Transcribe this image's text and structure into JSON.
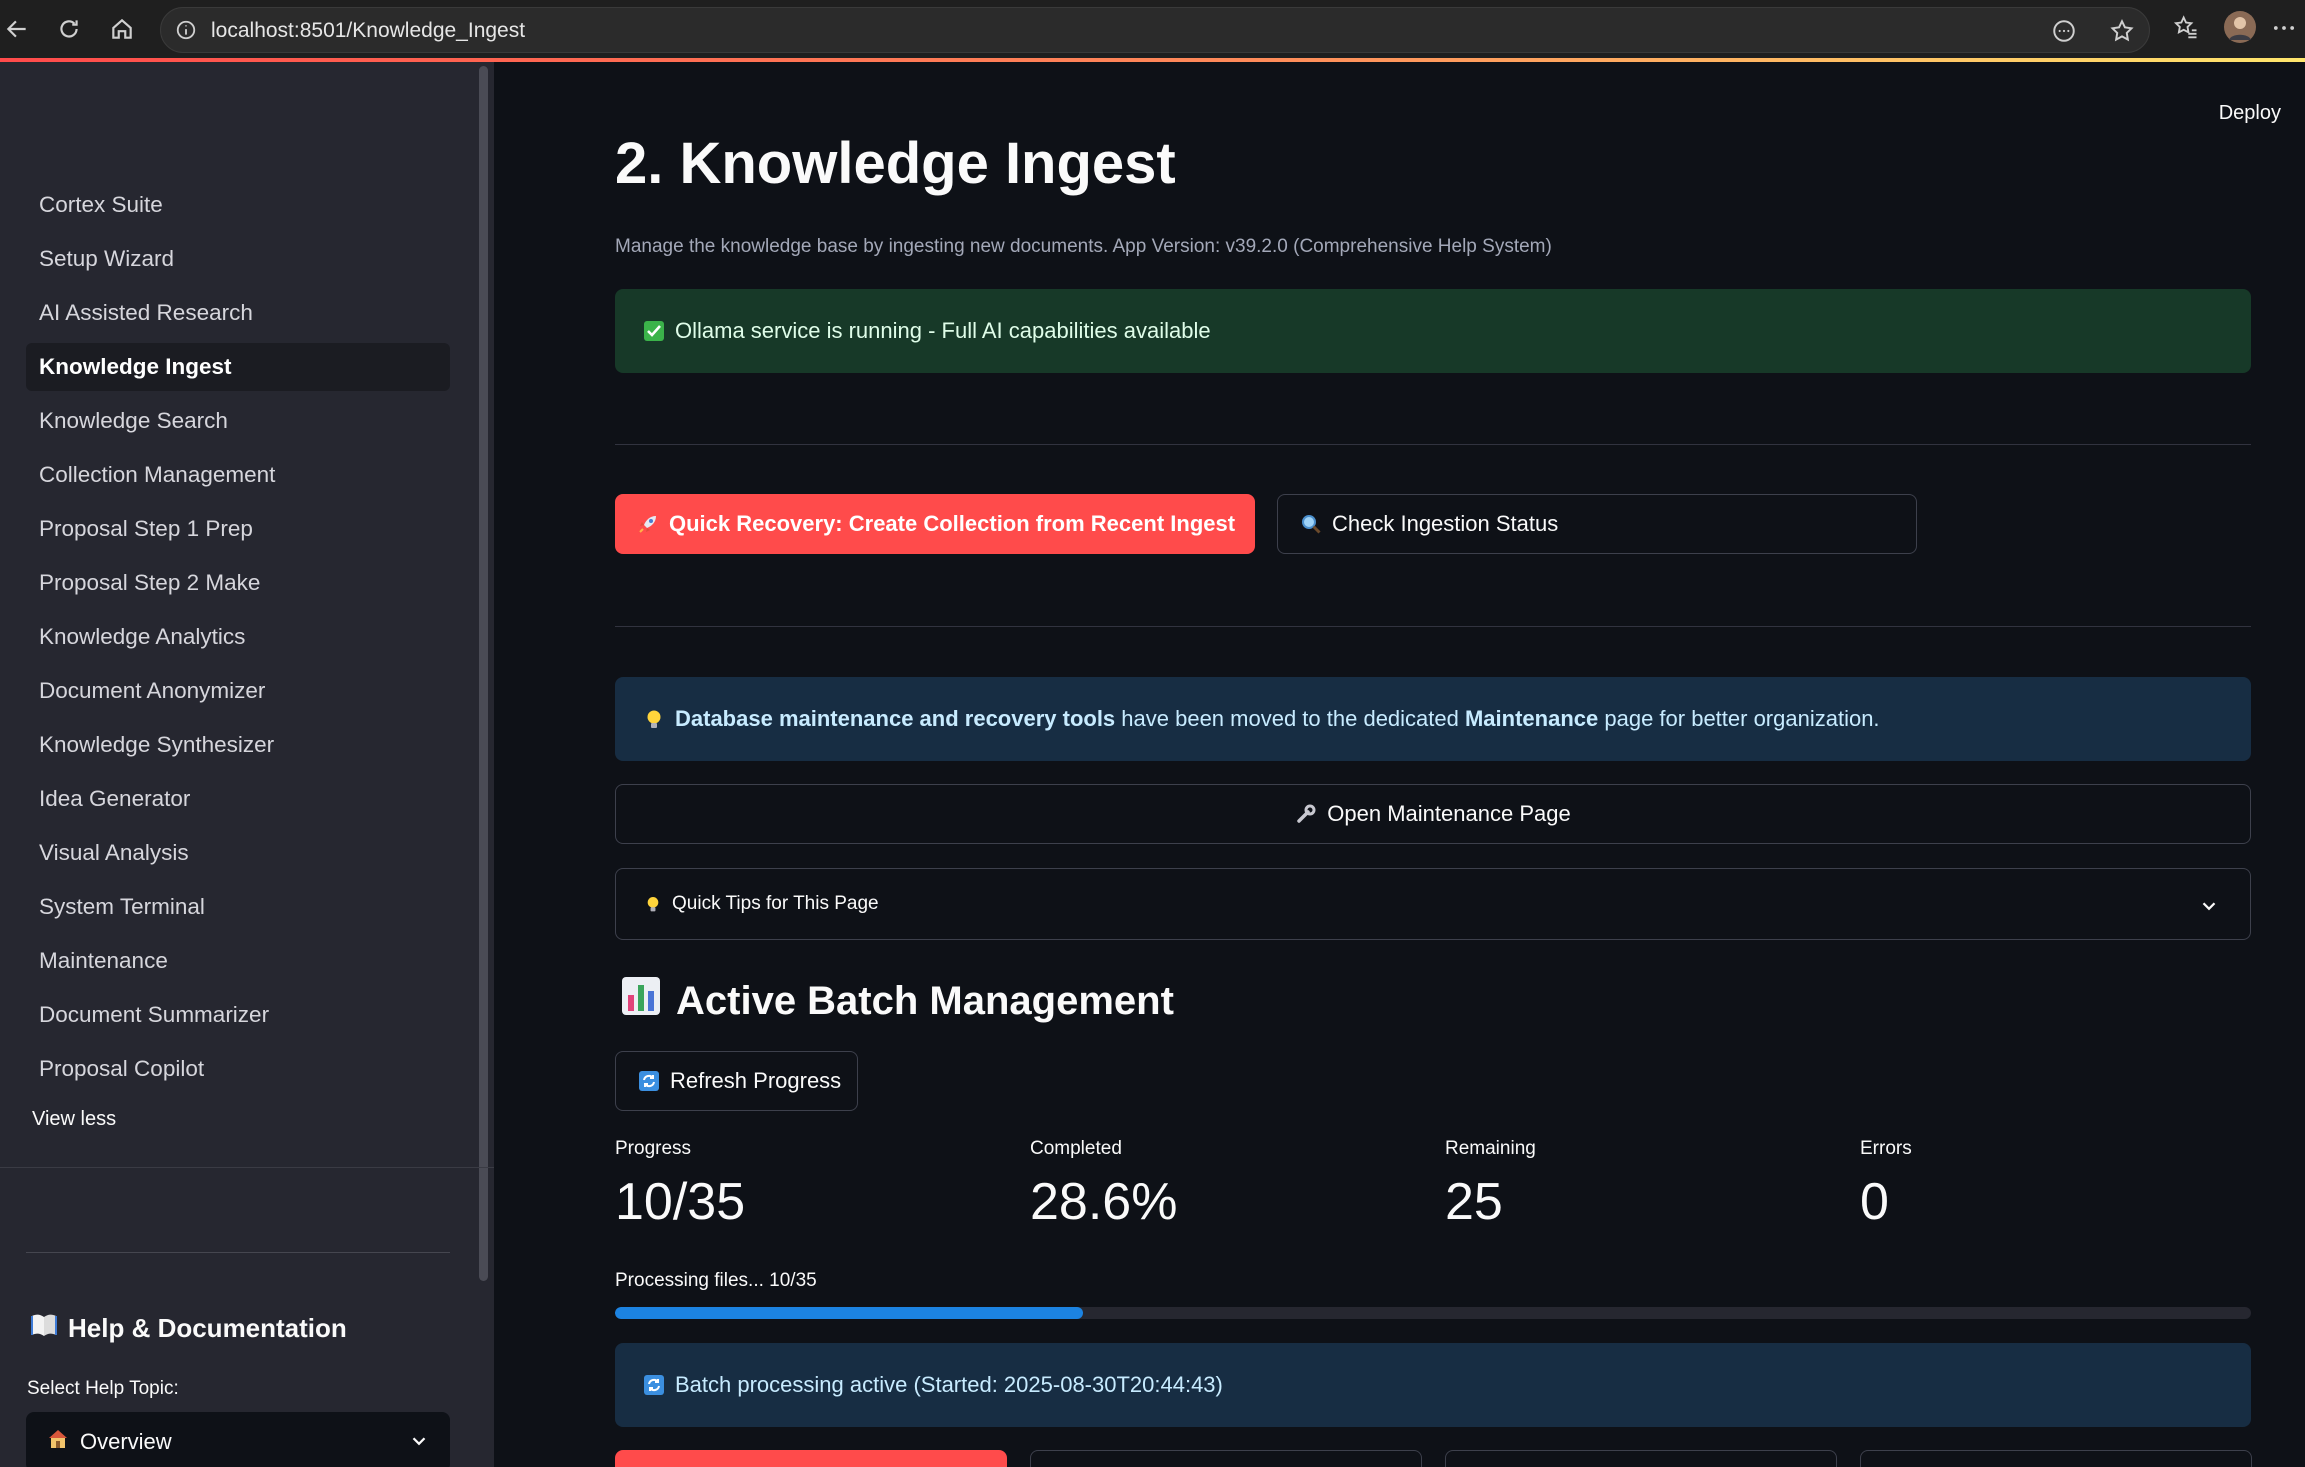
{
  "browser": {
    "url": "localhost:8501/Knowledge_Ingest"
  },
  "sidebar": {
    "items": [
      {
        "label": "Cortex Suite",
        "active": false
      },
      {
        "label": "Setup Wizard",
        "active": false
      },
      {
        "label": "AI Assisted Research",
        "active": false
      },
      {
        "label": "Knowledge Ingest",
        "active": true
      },
      {
        "label": "Knowledge Search",
        "active": false
      },
      {
        "label": "Collection Management",
        "active": false
      },
      {
        "label": "Proposal Step 1 Prep",
        "active": false
      },
      {
        "label": "Proposal Step 2 Make",
        "active": false
      },
      {
        "label": "Knowledge Analytics",
        "active": false
      },
      {
        "label": "Document Anonymizer",
        "active": false
      },
      {
        "label": "Knowledge Synthesizer",
        "active": false
      },
      {
        "label": "Idea Generator",
        "active": false
      },
      {
        "label": "Visual Analysis",
        "active": false
      },
      {
        "label": "System Terminal",
        "active": false
      },
      {
        "label": "Maintenance",
        "active": false
      },
      {
        "label": "Document Summarizer",
        "active": false
      },
      {
        "label": "Proposal Copilot",
        "active": false
      }
    ],
    "view_less": "View less",
    "help_heading": "Help & Documentation",
    "help_topic_label": "Select Help Topic:",
    "help_topic_value": "Overview"
  },
  "header": {
    "deploy": "Deploy"
  },
  "main": {
    "title": "2. Knowledge Ingest",
    "caption": "Manage the knowledge base by ingesting new documents. App Version: v39.2.0 (Comprehensive Help System)",
    "ollama_status": "Ollama service is running - Full AI capabilities available",
    "quick_recovery_button": "Quick Recovery: Create Collection from Recent Ingest",
    "check_status_button": "Check Ingestion Status",
    "maintenance_notice": {
      "bold1": "Database maintenance and recovery tools",
      "text1": " have been moved to the dedicated ",
      "bold2": "Maintenance",
      "text2": " page for better organization."
    },
    "open_maintenance_button": "Open Maintenance Page",
    "quick_tips": "Quick Tips for This Page",
    "batch_heading": "Active Batch Management",
    "refresh_button": "Refresh Progress",
    "metrics": [
      {
        "label": "Progress",
        "value": "10/35"
      },
      {
        "label": "Completed",
        "value": "28.6%"
      },
      {
        "label": "Remaining",
        "value": "25"
      },
      {
        "label": "Errors",
        "value": "0"
      }
    ],
    "progress_text": "Processing files... 10/35",
    "progress_fraction": 0.286,
    "batch_status": "Batch processing active (Started: 2025-08-30T20:44:43)"
  },
  "colors": {
    "primary": "#ff4b4b",
    "success_bg": "#173928",
    "info_bg": "#172d43",
    "progress": "#1c83e1"
  }
}
